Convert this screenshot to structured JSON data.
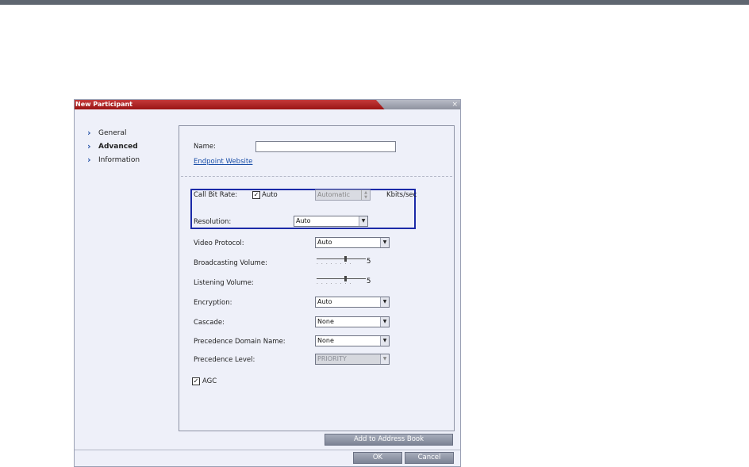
{
  "dialog": {
    "title": "New Participant",
    "close_glyph": "×"
  },
  "nav": {
    "chevron": "›",
    "items": [
      {
        "label": "General",
        "active": false
      },
      {
        "label": "Advanced",
        "active": true
      },
      {
        "label": "Information",
        "active": false
      }
    ]
  },
  "form": {
    "name_label": "Name:",
    "name_value": "",
    "endpoint_link": "Endpoint Website",
    "call_bit_rate_label": "Call Bit Rate:",
    "auto_checkbox_label": "Auto",
    "auto_checked": "✓",
    "bitrate_value": "Automatic",
    "bitrate_unit": "Kbits/sec",
    "resolution_label": "Resolution:",
    "resolution_value": "Auto",
    "video_protocol_label": "Video Protocol:",
    "video_protocol_value": "Auto",
    "broadcasting_volume_label": "Broadcasting Volume:",
    "broadcasting_volume_value": "5",
    "listening_volume_label": "Listening Volume:",
    "listening_volume_value": "5",
    "encryption_label": "Encryption:",
    "encryption_value": "Auto",
    "cascade_label": "Cascade:",
    "cascade_value": "None",
    "precedence_domain_label": "Precedence Domain Name:",
    "precedence_domain_value": "None",
    "precedence_level_label": "Precedence Level:",
    "precedence_level_value": "PRIORITY",
    "agc_label": "AGC",
    "agc_checked": "✓"
  },
  "buttons": {
    "add_to_address_book": "Add to Address Book",
    "ok": "OK",
    "cancel": "Cancel"
  },
  "icons": {
    "dropdown": "dropdown-arrow-icon",
    "spinner": "spinner-arrows-icon",
    "chevron": "chevron-right-icon",
    "close": "close-icon"
  },
  "colors": {
    "titlebar": "#b01e1e",
    "highlight_border": "#1b2aa8",
    "link": "#1a4fa8"
  }
}
